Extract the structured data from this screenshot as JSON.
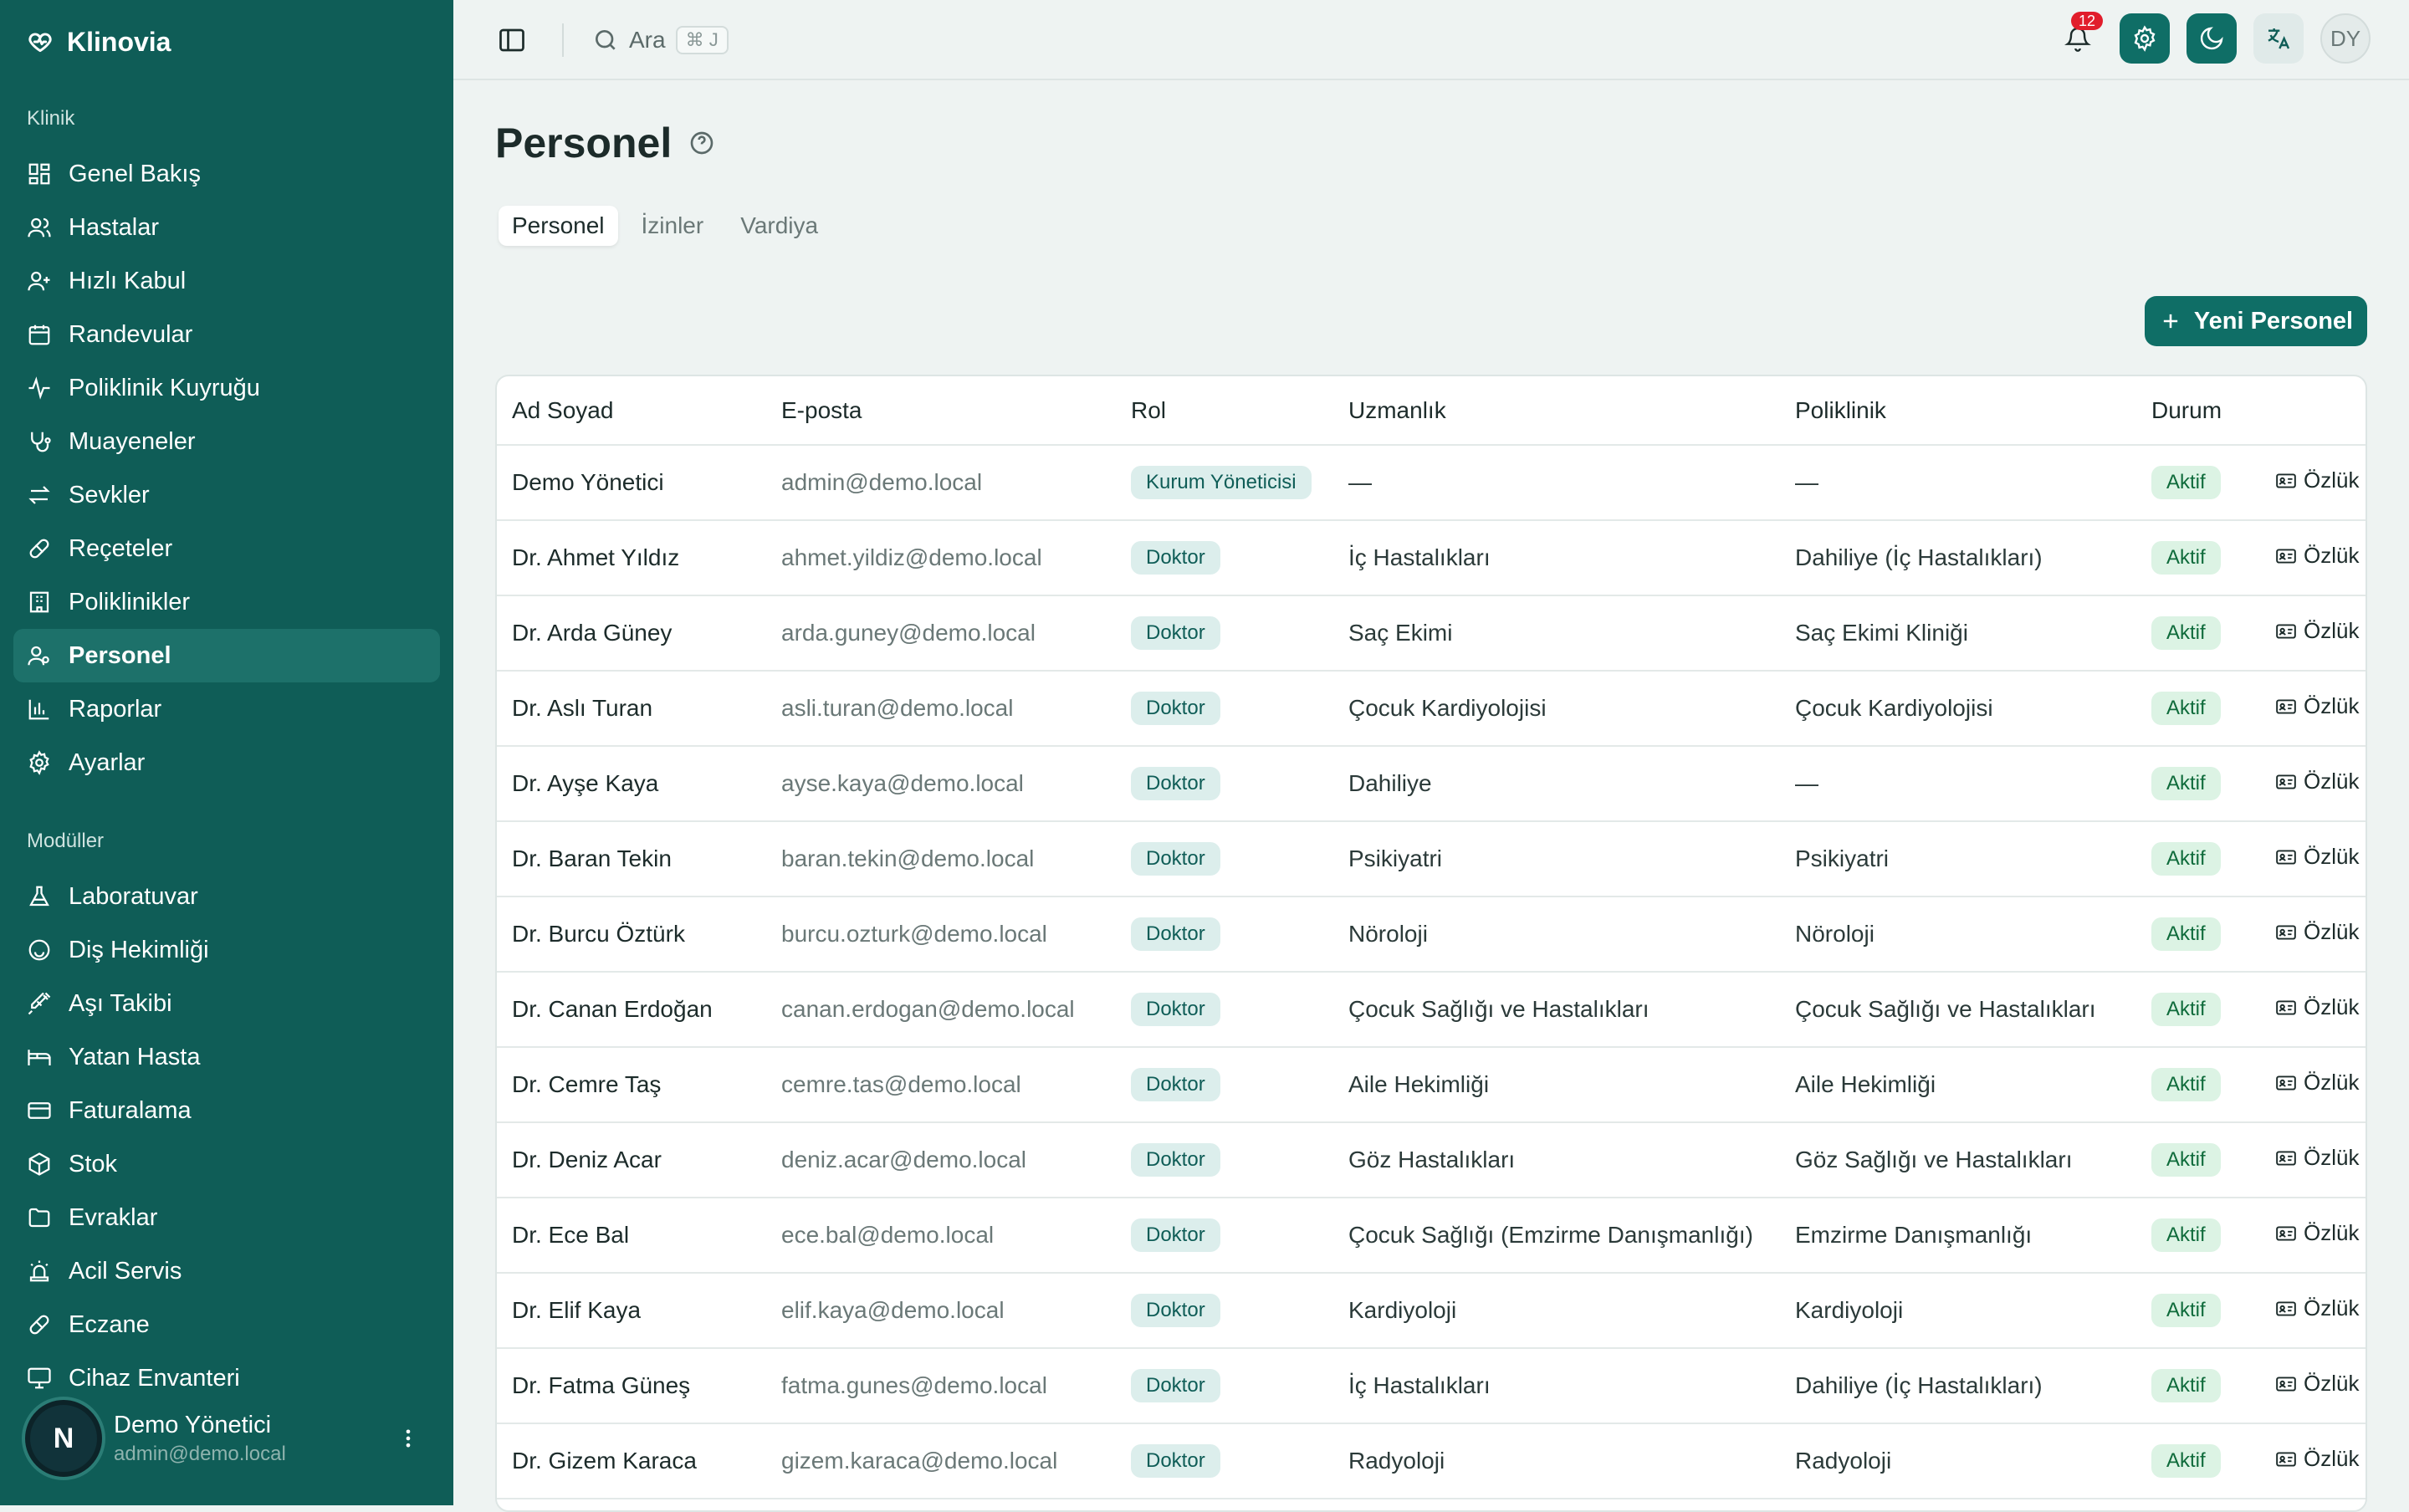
{
  "app": {
    "brand": "Klinovia"
  },
  "sidebar": {
    "section_clinic": "Klinik",
    "clinic_items": [
      {
        "label": "Genel Bakış",
        "icon": "dashboard-icon"
      },
      {
        "label": "Hastalar",
        "icon": "users-icon"
      },
      {
        "label": "Hızlı Kabul",
        "icon": "user-plus-icon"
      },
      {
        "label": "Randevular",
        "icon": "calendar-icon"
      },
      {
        "label": "Poliklinik Kuyruğu",
        "icon": "activity-icon"
      },
      {
        "label": "Muayeneler",
        "icon": "stethoscope-icon"
      },
      {
        "label": "Sevkler",
        "icon": "arrows-icon"
      },
      {
        "label": "Reçeteler",
        "icon": "pill-icon"
      },
      {
        "label": "Poliklinikler",
        "icon": "building-icon"
      },
      {
        "label": "Personel",
        "icon": "staff-icon",
        "active": true
      },
      {
        "label": "Raporlar",
        "icon": "bar-chart-icon"
      },
      {
        "label": "Ayarlar",
        "icon": "gear-icon"
      }
    ],
    "section_modules": "Modüller",
    "module_items": [
      {
        "label": "Laboratuvar",
        "icon": "flask-icon"
      },
      {
        "label": "Diş Hekimliği",
        "icon": "smile-icon"
      },
      {
        "label": "Aşı Takibi",
        "icon": "syringe-icon"
      },
      {
        "label": "Yatan Hasta",
        "icon": "bed-icon"
      },
      {
        "label": "Faturalama",
        "icon": "credit-card-icon"
      },
      {
        "label": "Stok",
        "icon": "package-icon"
      },
      {
        "label": "Evraklar",
        "icon": "folder-icon"
      },
      {
        "label": "Acil Servis",
        "icon": "siren-icon"
      },
      {
        "label": "Eczane",
        "icon": "pill-icon"
      },
      {
        "label": "Cihaz Envanteri",
        "icon": "monitor-icon"
      }
    ],
    "user": {
      "avatar": "N",
      "name": "Demo Yönetici",
      "email": "admin@demo.local"
    }
  },
  "topbar": {
    "search_placeholder": "Ara",
    "search_shortcut": "⌘ J",
    "notifications_count": "12",
    "user_initials": "DY"
  },
  "page": {
    "title": "Personel",
    "tabs": [
      "Personel",
      "İzinler",
      "Vardiya"
    ],
    "active_tab": 0,
    "new_button": "Yeni Personel"
  },
  "table": {
    "columns": [
      "Ad Soyad",
      "E-posta",
      "Rol",
      "Uzmanlık",
      "Poliklinik",
      "Durum",
      ""
    ],
    "action_label": "Özlük",
    "rows": [
      {
        "name": "Demo Yönetici",
        "email": "admin@demo.local",
        "role": "Kurum Yöneticisi",
        "specialty": "—",
        "clinic": "—",
        "status": "Aktif"
      },
      {
        "name": "Dr. Ahmet Yıldız",
        "email": "ahmet.yildiz@demo.local",
        "role": "Doktor",
        "specialty": "İç Hastalıkları",
        "clinic": "Dahiliye (İç Hastalıkları)",
        "status": "Aktif"
      },
      {
        "name": "Dr. Arda Güney",
        "email": "arda.guney@demo.local",
        "role": "Doktor",
        "specialty": "Saç Ekimi",
        "clinic": "Saç Ekimi Kliniği",
        "status": "Aktif"
      },
      {
        "name": "Dr. Aslı Turan",
        "email": "asli.turan@demo.local",
        "role": "Doktor",
        "specialty": "Çocuk Kardiyolojisi",
        "clinic": "Çocuk Kardiyolojisi",
        "status": "Aktif"
      },
      {
        "name": "Dr. Ayşe Kaya",
        "email": "ayse.kaya@demo.local",
        "role": "Doktor",
        "specialty": "Dahiliye",
        "clinic": "—",
        "status": "Aktif"
      },
      {
        "name": "Dr. Baran Tekin",
        "email": "baran.tekin@demo.local",
        "role": "Doktor",
        "specialty": "Psikiyatri",
        "clinic": "Psikiyatri",
        "status": "Aktif"
      },
      {
        "name": "Dr. Burcu Öztürk",
        "email": "burcu.ozturk@demo.local",
        "role": "Doktor",
        "specialty": "Nöroloji",
        "clinic": "Nöroloji",
        "status": "Aktif"
      },
      {
        "name": "Dr. Canan Erdoğan",
        "email": "canan.erdogan@demo.local",
        "role": "Doktor",
        "specialty": "Çocuk Sağlığı ve Hastalıkları",
        "clinic": "Çocuk Sağlığı ve Hastalıkları",
        "status": "Aktif"
      },
      {
        "name": "Dr. Cemre Taş",
        "email": "cemre.tas@demo.local",
        "role": "Doktor",
        "specialty": "Aile Hekimliği",
        "clinic": "Aile Hekimliği",
        "status": "Aktif"
      },
      {
        "name": "Dr. Deniz Acar",
        "email": "deniz.acar@demo.local",
        "role": "Doktor",
        "specialty": "Göz Hastalıkları",
        "clinic": "Göz Sağlığı ve Hastalıkları",
        "status": "Aktif"
      },
      {
        "name": "Dr. Ece Bal",
        "email": "ece.bal@demo.local",
        "role": "Doktor",
        "specialty": "Çocuk Sağlığı (Emzirme Danışmanlığı)",
        "clinic": "Emzirme Danışmanlığı",
        "status": "Aktif"
      },
      {
        "name": "Dr. Elif Kaya",
        "email": "elif.kaya@demo.local",
        "role": "Doktor",
        "specialty": "Kardiyoloji",
        "clinic": "Kardiyoloji",
        "status": "Aktif"
      },
      {
        "name": "Dr. Fatma Güneş",
        "email": "fatma.gunes@demo.local",
        "role": "Doktor",
        "specialty": "İç Hastalıkları",
        "clinic": "Dahiliye (İç Hastalıkları)",
        "status": "Aktif"
      },
      {
        "name": "Dr. Gizem Karaca",
        "email": "gizem.karaca@demo.local",
        "role": "Doktor",
        "specialty": "Radyoloji",
        "clinic": "Radyoloji",
        "status": "Aktif"
      }
    ]
  },
  "colors": {
    "sidebar_bg": "#0f5d57",
    "accent": "#0f6e66",
    "status_active_bg": "#dcf3e4",
    "role_bg": "#dceeec",
    "badge_red": "#e11d2b"
  }
}
